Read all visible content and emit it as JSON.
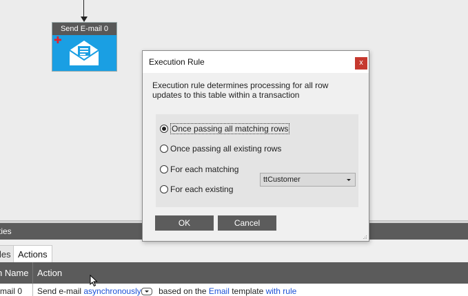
{
  "canvas": {
    "node": {
      "title": "Send E-mail 0",
      "icon": "envelope-icon",
      "add_icon": "plus-icon",
      "accent": "#1a9fe3"
    }
  },
  "dialog": {
    "title": "Execution Rule",
    "close_label": "x",
    "description": "Execution rule determines processing for all row updates to this table within a transaction",
    "options": [
      {
        "label": "Once passing all matching rows",
        "checked": true
      },
      {
        "label": "Once passing all existing rows",
        "checked": false
      },
      {
        "label": "For each matching",
        "checked": false
      },
      {
        "label": "For each existing",
        "checked": false
      }
    ],
    "table_select": {
      "value": "ttCustomer"
    },
    "ok_label": "OK",
    "cancel_label": "Cancel"
  },
  "properties": {
    "header": "ties",
    "tabs": [
      {
        "label": "les"
      },
      {
        "label": "Actions"
      }
    ],
    "grid": {
      "columns": [
        "n Name",
        "Action"
      ],
      "row": {
        "name": "-mail 0",
        "action_prefix": "Send e-mail",
        "mode_link": "asynchronously",
        "action_mid": "based on the",
        "template_link": "Email",
        "action_suffix": "template",
        "rule_link": "with rule"
      }
    }
  }
}
